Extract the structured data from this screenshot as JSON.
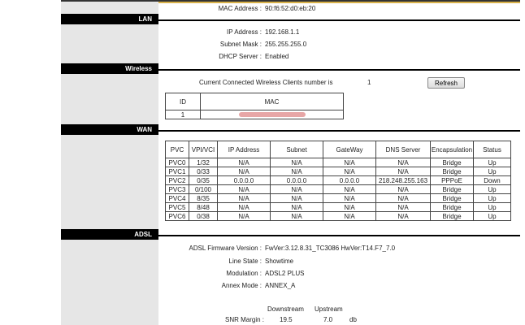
{
  "device": {
    "mac_label": "MAC Address :",
    "mac_value": "90:f6:52:d0:eb:20"
  },
  "sections": {
    "lan": "LAN",
    "wireless": "Wireless",
    "wan": "WAN",
    "adsl": "ADSL"
  },
  "lan": {
    "ip_label": "IP Address :",
    "ip_value": "192.168.1.1",
    "mask_label": "Subnet Mask :",
    "mask_value": "255.255.255.0",
    "dhcp_label": "DHCP Server :",
    "dhcp_value": "Enabled"
  },
  "wireless": {
    "clients_text": "Current Connected Wireless Clients number is",
    "clients_count": "1",
    "refresh_label": "Refresh",
    "table_headers": [
      "ID",
      "MAC"
    ],
    "rows": [
      {
        "id": "1"
      }
    ]
  },
  "wan": {
    "headers": [
      "PVC",
      "VPI/VCI",
      "IP Address",
      "Subnet",
      "GateWay",
      "DNS Server",
      "Encapsulation",
      "Status"
    ],
    "rows": [
      [
        "PVC0",
        "1/32",
        "N/A",
        "N/A",
        "N/A",
        "N/A",
        "Bridge",
        "Up"
      ],
      [
        "PVC1",
        "0/33",
        "N/A",
        "N/A",
        "N/A",
        "N/A",
        "Bridge",
        "Up"
      ],
      [
        "PVC2",
        "0/35",
        "0.0.0.0",
        "0.0.0.0",
        "0.0.0.0",
        "218.248.255.163",
        "PPPoE",
        "Down"
      ],
      [
        "PVC3",
        "0/100",
        "N/A",
        "N/A",
        "N/A",
        "N/A",
        "Bridge",
        "Up"
      ],
      [
        "PVC4",
        "8/35",
        "N/A",
        "N/A",
        "N/A",
        "N/A",
        "Bridge",
        "Up"
      ],
      [
        "PVC5",
        "8/48",
        "N/A",
        "N/A",
        "N/A",
        "N/A",
        "Bridge",
        "Up"
      ],
      [
        "PVC6",
        "0/38",
        "N/A",
        "N/A",
        "N/A",
        "N/A",
        "Bridge",
        "Up"
      ]
    ]
  },
  "adsl": {
    "fw_label": "ADSL Firmware Version :",
    "fw_value": "FwVer:3.12.8.31_TC3086 HwVer:T14.F7_7.0",
    "line_label": "Line State :",
    "line_value": "Showtime",
    "mod_label": "Modulation :",
    "mod_value": "ADSL2 PLUS",
    "annex_label": "Annex Mode :",
    "annex_value": "ANNEX_A",
    "downstream_label": "Downstream",
    "upstream_label": "Upstream",
    "snr_label": "SNR Margin :",
    "snr_down": "19.5",
    "snr_up": "7.0",
    "snr_unit": "db"
  }
}
